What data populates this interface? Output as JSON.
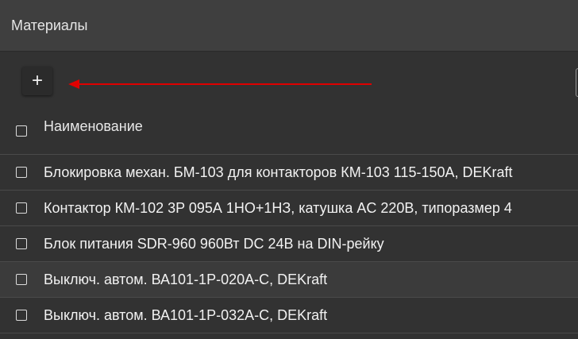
{
  "header": {
    "title": "Материалы"
  },
  "toolbar": {
    "add_label": "+"
  },
  "table": {
    "column_header": "Наименование",
    "rows": [
      "Блокировка механ. БМ-103 для контакторов КМ-103 115-150А, DEKraft",
      "Контактор КМ-102 3P 095А 1НО+1НЗ, катушка AC 220В, типоразмер 4",
      "Блок питания SDR-960 960Вт DC 24В на DIN-рейку",
      "Выключ. автом. ВА101-1P-020A-C, DEKraft",
      "Выключ. автом. ВА101-1P-032A-C, DEKraft"
    ]
  },
  "colors": {
    "arrow": "#e00000",
    "background": "#323232",
    "header_bg": "#3f3f3f"
  },
  "icons": {
    "add": "plus-icon",
    "arrow": "red-arrow-annotation"
  }
}
